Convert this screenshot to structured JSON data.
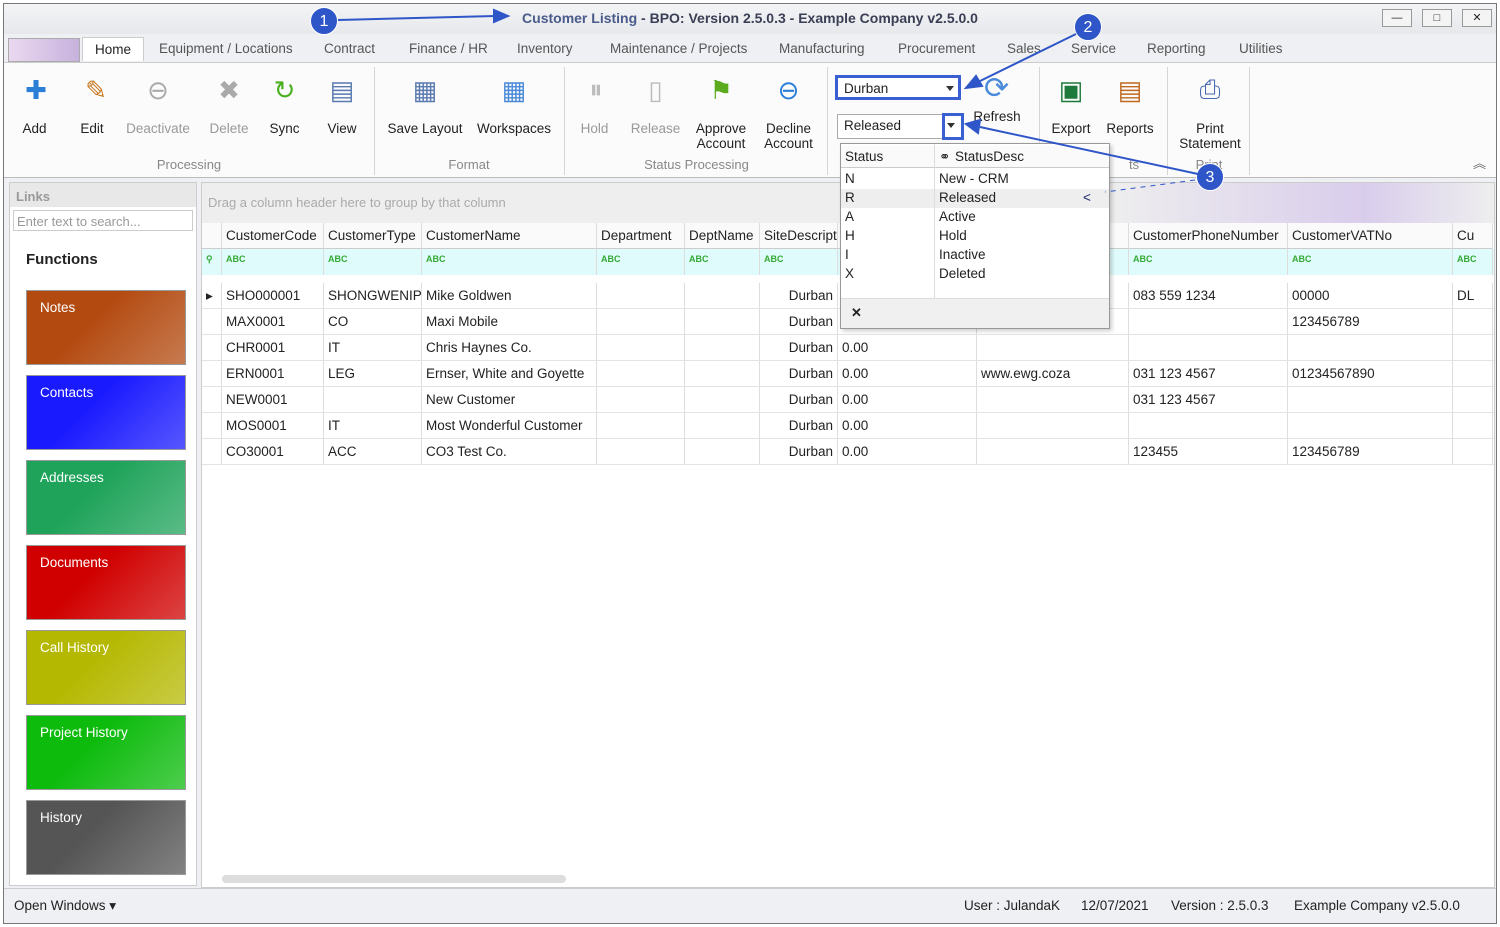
{
  "window": {
    "title_part1": "Customer Listing",
    "title_part2": " - BPO: Version 2.5.0.3 - Example Company v2.5.0.0"
  },
  "tabs": [
    "Home",
    "Equipment / Locations",
    "Contract",
    "Finance / HR",
    "Inventory",
    "Maintenance / Projects",
    "Manufacturing",
    "Procurement",
    "Sales",
    "Service",
    "Reporting",
    "Utilities"
  ],
  "ribbon": {
    "buttons": [
      {
        "label": "Add",
        "icon": "add-icon"
      },
      {
        "label": "Edit",
        "icon": "edit-icon"
      },
      {
        "label": "Deactivate",
        "icon": "deactivate-icon"
      },
      {
        "label": "Delete",
        "icon": "delete-icon"
      },
      {
        "label": "Sync",
        "icon": "sync-icon"
      },
      {
        "label": "View",
        "icon": "view-icon"
      },
      {
        "label": "Save Layout",
        "icon": "save-layout-icon"
      },
      {
        "label": "Workspaces",
        "icon": "workspaces-icon"
      },
      {
        "label": "Hold",
        "icon": "hold-icon"
      },
      {
        "label": "Release",
        "icon": "release-icon"
      },
      {
        "label": "Approve Account",
        "icon": "flag-icon"
      },
      {
        "label": "Decline Account",
        "icon": "decline-icon"
      },
      {
        "label": "Refresh",
        "icon": "refresh-icon"
      },
      {
        "label": "Export",
        "icon": "excel-icon"
      },
      {
        "label": "Reports",
        "icon": "reports-icon"
      },
      {
        "label": "Print Statement",
        "icon": "printer-icon"
      }
    ],
    "groups": [
      "Processing",
      "Format",
      "Status Processing",
      "ts",
      "Print"
    ],
    "site_combo": "Durban",
    "status_combo": "Released"
  },
  "popup": {
    "headers": [
      "Status",
      "StatusDesc"
    ],
    "rows": [
      [
        "N",
        "New - CRM"
      ],
      [
        "R",
        "Released"
      ],
      [
        "A",
        "Active"
      ],
      [
        "H",
        "Hold"
      ],
      [
        "I",
        "Inactive"
      ],
      [
        "X",
        "Deleted"
      ]
    ],
    "close": "✕"
  },
  "links": {
    "title": "Links",
    "search_placeholder": "Enter text to search...",
    "functions": "Functions",
    "tiles": [
      {
        "label": "Notes",
        "color": "#b34a10"
      },
      {
        "label": "Contacts",
        "color": "#1a1aff"
      },
      {
        "label": "Addresses",
        "color": "#1fa35a"
      },
      {
        "label": "Documents",
        "color": "#d00000"
      },
      {
        "label": "Call History",
        "color": "#b5b800"
      },
      {
        "label": "Project History",
        "color": "#0dbb0d"
      },
      {
        "label": "History",
        "color": "#555555"
      }
    ]
  },
  "grid": {
    "group_hint": "Drag a column header here to group by that column",
    "headers": [
      "CustomerCode",
      "CustomerType",
      "CustomerName",
      "Department",
      "DeptName",
      "SiteDescripti",
      "",
      "e",
      "CustomerPhoneNumber",
      "CustomerVATNo",
      "Cu"
    ],
    "rows": [
      [
        "SHO000001",
        "SHONGWENIP",
        "Mike Goldwen",
        "",
        "",
        "Durban",
        "",
        "",
        "083 559 1234",
        "00000",
        "DL"
      ],
      [
        "MAX0001",
        "CO",
        "Maxi Mobile",
        "",
        "",
        "Durban",
        "",
        "",
        "",
        "123456789",
        ""
      ],
      [
        "CHR0001",
        "IT",
        "Chris Haynes Co.",
        "",
        "",
        "Durban",
        "0.00",
        "",
        "",
        "",
        ""
      ],
      [
        "ERN0001",
        "LEG",
        "Ernser, White and Goyette",
        "",
        "",
        "Durban",
        "0.00",
        "www.ewg.coza",
        "031 123 4567",
        "01234567890",
        ""
      ],
      [
        "NEW0001",
        "",
        "New Customer",
        "",
        "",
        "Durban",
        "0.00",
        "",
        "031 123 4567",
        "",
        ""
      ],
      [
        "MOS0001",
        "IT",
        "Most Wonderful Customer",
        "",
        "",
        "Durban",
        "0.00",
        "",
        "",
        "",
        ""
      ],
      [
        "CO30001",
        "ACC",
        "CO3 Test Co.",
        "",
        "",
        "Durban",
        "0.00",
        "",
        "123455",
        "123456789",
        ""
      ]
    ]
  },
  "statusbar": {
    "open_windows": "Open Windows ▾",
    "user": "User : JulandaK",
    "date": "12/07/2021",
    "version": "Version : 2.5.0.3",
    "company": "Example Company v2.5.0.0"
  },
  "annotations": [
    "1",
    "2",
    "3"
  ]
}
